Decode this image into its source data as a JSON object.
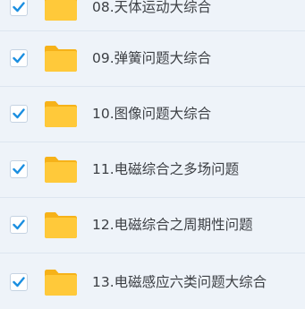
{
  "file_list": {
    "items": [
      {
        "label": "08.天体运动大综合",
        "checked": true
      },
      {
        "label": "09.弹簧问题大综合",
        "checked": true
      },
      {
        "label": "10.图像问题大综合",
        "checked": true
      },
      {
        "label": "11.电磁综合之多场问题",
        "checked": true
      },
      {
        "label": "12.电磁综合之周期性问题",
        "checked": true
      },
      {
        "label": "13.电磁感应六类问题大综合",
        "checked": true
      }
    ]
  },
  "colors": {
    "check_mark": "#1a8ee0",
    "folder_front": "#ffc93a",
    "folder_back": "#f6b219",
    "row_background": "#eef3f9"
  }
}
